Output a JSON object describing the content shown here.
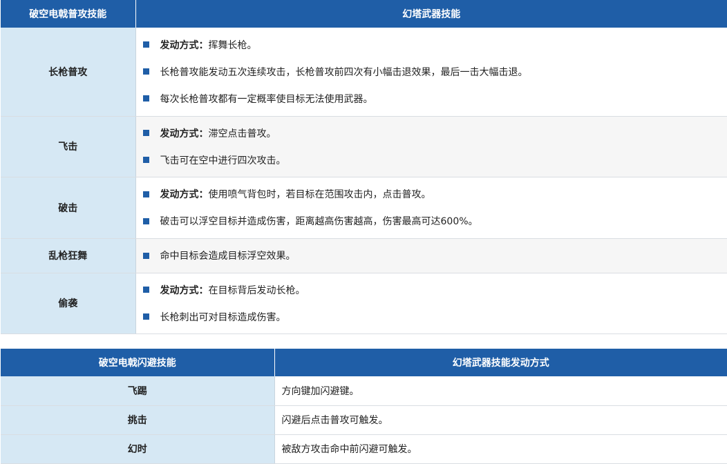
{
  "table1": {
    "headers": [
      "破空电戟普攻技能",
      "幻塔武器技能"
    ],
    "rows": [
      {
        "name": "长枪普攻",
        "lines": [
          {
            "kw": "发动方式：",
            "text": "挥舞长枪。"
          },
          {
            "kw": "",
            "text": "长枪普攻能发动五次连续攻击，长枪普攻前四次有小幅击退效果，最后一击大幅击退。"
          },
          {
            "kw": "",
            "text": "每次长枪普攻都有一定概率使目标无法使用武器。"
          }
        ]
      },
      {
        "name": "飞击",
        "lines": [
          {
            "kw": "发动方式：",
            "text": "滞空点击普攻。"
          },
          {
            "kw": "",
            "text": "飞击可在空中进行四次攻击。"
          }
        ]
      },
      {
        "name": "破击",
        "lines": [
          {
            "kw": "发动方式：",
            "text": "使用喷气背包时，若目标在范围攻击内，点击普攻。"
          },
          {
            "kw": "",
            "text": "破击可以浮空目标并造成伤害，距离越高伤害越高，伤害最高可达600%。"
          }
        ]
      },
      {
        "name": "乱枪狂舞",
        "lines": [
          {
            "kw": "",
            "text": "命中目标会造成目标浮空效果。"
          }
        ]
      },
      {
        "name": "偷袭",
        "lines": [
          {
            "kw": "发动方式：",
            "text": "在目标背后发动长枪。"
          },
          {
            "kw": "",
            "text": "长枪刺出可对目标造成伤害。"
          }
        ]
      }
    ]
  },
  "table2": {
    "headers": [
      "破空电戟闪避技能",
      "幻塔武器技能发动方式"
    ],
    "rows": [
      {
        "name": "飞踢",
        "text": "方向键加闪避键。"
      },
      {
        "name": "挑击",
        "text": "闪避后点击普攻可触发。"
      },
      {
        "name": "幻时",
        "text": "被敌方攻击命中前闪避可触发。"
      }
    ]
  },
  "colors": {
    "header": "#1f5ea7",
    "name_cell": "#d6e8f4",
    "bullet": "#1f5ea7"
  }
}
